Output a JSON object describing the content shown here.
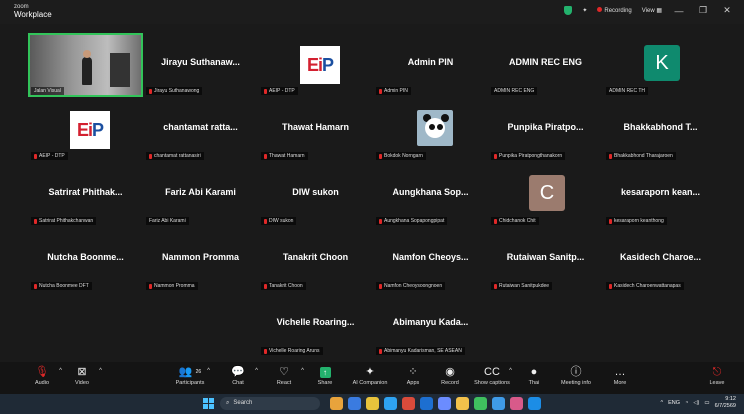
{
  "window": {
    "brand_small": "zoom",
    "brand": "Workplace",
    "recording": "Recording",
    "view_label": "View",
    "view_icon": "grid-icon",
    "minimize": "—",
    "maximize": "❐",
    "close": "✕"
  },
  "tiles": [
    {
      "kind": "video",
      "name": "Jalan Visual",
      "active": true
    },
    {
      "kind": "text",
      "display": "Jirayu Suthanaw...",
      "name": "Jirayu Suthanawong",
      "muted": true
    },
    {
      "kind": "eip",
      "name": "AEIP - DTP",
      "muted": true
    },
    {
      "kind": "text",
      "display": "Admin PIN",
      "name": "Admin PIN",
      "muted": true
    },
    {
      "kind": "text",
      "display": "ADMIN REC ENG",
      "name": "ADMIN REC ENG",
      "muted": false
    },
    {
      "kind": "avatar",
      "letter": "K",
      "color": "#0f8a6e",
      "name": "ADMIN REC TH",
      "muted": false
    },
    {
      "kind": "eip",
      "name": "AEIP - DTP",
      "muted": true
    },
    {
      "kind": "text",
      "display": "chantamat ratta...",
      "name": "chantamat rattanasiri",
      "muted": true
    },
    {
      "kind": "text",
      "display": "Thawat Hamarn",
      "name": "Thawat Hamarn",
      "muted": true
    },
    {
      "kind": "panda",
      "name": "Bokdok Norngarn",
      "muted": true
    },
    {
      "kind": "text",
      "display": "Punpika Piratpo...",
      "name": "Punpika Piratpongthanakorn",
      "muted": true
    },
    {
      "kind": "text",
      "display": "Bhakkabhond T...",
      "name": "Bhakkabhond Tharajaroen",
      "muted": true
    },
    {
      "kind": "text",
      "display": "Satrirat Phithak...",
      "name": "Satrirat Phithakchanwan",
      "muted": true
    },
    {
      "kind": "text",
      "display": "Fariz Abi Karami",
      "name": "Fariz Abi Karami",
      "muted": false
    },
    {
      "kind": "text",
      "display": "DIW sukon",
      "name": "DIW sukon",
      "muted": true
    },
    {
      "kind": "text",
      "display": "Aungkhana Sop...",
      "name": "Aungkhana Sopapongpipat",
      "muted": true
    },
    {
      "kind": "avatar",
      "letter": "C",
      "color": "#9b7b6e",
      "name": "Chidchanok Chit",
      "muted": true
    },
    {
      "kind": "text",
      "display": "kesaraporn kean...",
      "name": "kesaraporn keanthong",
      "muted": true
    },
    {
      "kind": "text",
      "display": "Nutcha Boonme...",
      "name": "Nutcha Boonmee DFT",
      "muted": true
    },
    {
      "kind": "text",
      "display": "Nammon Promma",
      "name": "Nammon Promma",
      "muted": true
    },
    {
      "kind": "text",
      "display": "Tanakrit Choon",
      "name": "Tanakrit Choon",
      "muted": true
    },
    {
      "kind": "text",
      "display": "Namfon Cheoys...",
      "name": "Namfon Cheoysoongnoen",
      "muted": true
    },
    {
      "kind": "text",
      "display": "Rutaiwan Sanitp...",
      "name": "Rutaiwan Sanitpukdee",
      "muted": true
    },
    {
      "kind": "text",
      "display": "Kasidech Charoe...",
      "name": "Kasidech Charoenwattanapas",
      "muted": true
    },
    {
      "kind": "text",
      "display": "Vichelle Roaring...",
      "name": "Vichelle Roaring Aruns",
      "muted": true
    },
    {
      "kind": "text",
      "display": "Abimanyu Kada...",
      "name": "Abimanyu Kadarisman, SE ASEAN",
      "muted": true
    }
  ],
  "toolbar": [
    {
      "id": "audio",
      "label": "Audio",
      "icon": "microphone-muted-icon",
      "glyph": "🎙",
      "arrow": true,
      "red": true
    },
    {
      "id": "video",
      "label": "Video",
      "icon": "camera-off-icon",
      "glyph": "⊠",
      "arrow": true,
      "red": false
    },
    {
      "id": "participants",
      "label": "Participants",
      "icon": "participants-icon",
      "glyph": "👥",
      "count": "26",
      "arrow": true
    },
    {
      "id": "chat",
      "label": "Chat",
      "icon": "chat-icon",
      "glyph": "💬",
      "arrow": true
    },
    {
      "id": "react",
      "label": "React",
      "icon": "heart-icon",
      "glyph": "♡",
      "arrow": true
    },
    {
      "id": "share",
      "label": "Share",
      "icon": "share-icon",
      "glyph": "↑",
      "green": true
    },
    {
      "id": "ai",
      "label": "AI Companion",
      "icon": "ai-sparkle-icon",
      "glyph": "✦"
    },
    {
      "id": "apps",
      "label": "Apps",
      "icon": "apps-icon",
      "glyph": "⁘"
    },
    {
      "id": "record",
      "label": "Record",
      "icon": "record-icon",
      "glyph": "◉"
    },
    {
      "id": "captions",
      "label": "Show captions",
      "icon": "captions-icon",
      "glyph": "CC",
      "arrow": true
    },
    {
      "id": "thai",
      "label": "Thai",
      "icon": "language-icon",
      "glyph": "●"
    },
    {
      "id": "info",
      "label": "Meeting info",
      "icon": "info-icon",
      "glyph": "ⓘ"
    },
    {
      "id": "more",
      "label": "More",
      "icon": "more-icon",
      "glyph": "…"
    },
    {
      "id": "leave",
      "label": "Leave",
      "icon": "leave-icon",
      "glyph": "⎋",
      "red": true
    }
  ],
  "taskbar": {
    "search": "Search",
    "lang": "ENG",
    "time": "9:12",
    "date": "6/7/2569",
    "app_colors": [
      "#e8a33c",
      "#3a7be0",
      "#e8c33c",
      "#2ea3f2",
      "#d94b3b",
      "#1d6fd1",
      "#6b8cff",
      "#f2c14b",
      "#3fbf5f",
      "#3f9be8",
      "#d85a8a",
      "#1c8de6"
    ]
  }
}
